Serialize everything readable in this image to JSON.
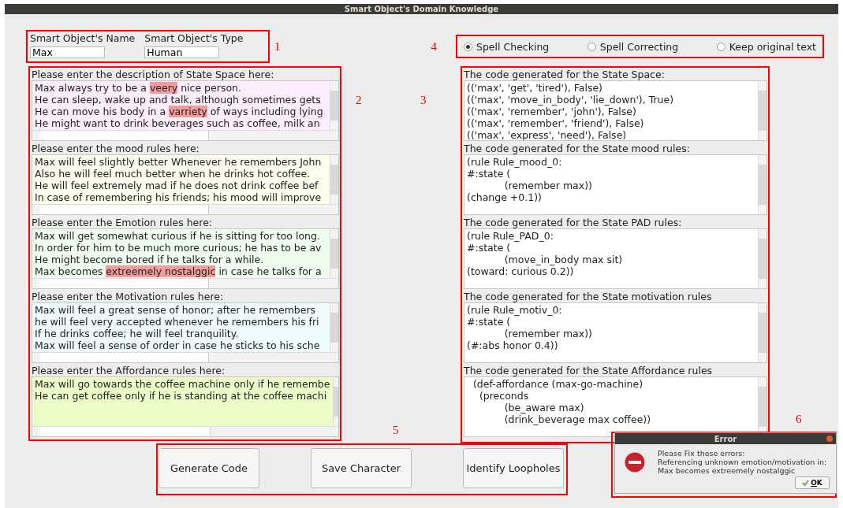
{
  "window": {
    "title": "Smart Object's Domain Knowledge"
  },
  "identity": {
    "marker": "1",
    "fields": [
      {
        "label": "Smart Object's Name",
        "value": "Max"
      },
      {
        "label": "Smart Object's Type",
        "value": "Human"
      }
    ]
  },
  "spell_mode": {
    "marker": "4",
    "options": [
      {
        "label": "Spell Checking",
        "selected": true
      },
      {
        "label": "Spell Correcting",
        "selected": false
      },
      {
        "label": "Keep original text",
        "selected": false
      }
    ]
  },
  "input_sections": {
    "marker": "2",
    "sections": [
      {
        "label": "Please enter the description of State Space here:",
        "color": "#fdeefd",
        "lines": [
          [
            {
              "text": "Max always try to be a ",
              "misspelled": false
            },
            {
              "text": "veery",
              "misspelled": true
            },
            {
              "text": " nice person.",
              "misspelled": false
            }
          ],
          [
            {
              "text": "He can sleep, wake up and talk, although sometimes gets",
              "misspelled": false
            }
          ],
          [
            {
              "text": "He can move his body in a ",
              "misspelled": false
            },
            {
              "text": "varriety",
              "misspelled": true
            },
            {
              "text": " of ways including lying",
              "misspelled": false
            }
          ],
          [
            {
              "text": "He might want to drink beverages such as coffee, milk an",
              "misspelled": false
            }
          ]
        ]
      },
      {
        "label": "Please enter the mood rules here:",
        "color": "#fefeef",
        "lines": [
          [
            {
              "text": "Max will feel slightly better Whenever he remembers John",
              "misspelled": false
            }
          ],
          [
            {
              "text": "Also he will feel much better when he drinks hot coffee.",
              "misspelled": false
            }
          ],
          [
            {
              "text": "He will feel extremely mad if he does not drink coffee bef",
              "misspelled": false
            }
          ],
          [
            {
              "text": "In case of remembering his friends; his mood will improve",
              "misspelled": false
            }
          ]
        ]
      },
      {
        "label": "Please enter the Emotion rules here:",
        "color": "#effdef",
        "lines": [
          [
            {
              "text": "Max will get somewhat curious if he is sitting for too long.",
              "misspelled": false
            }
          ],
          [
            {
              "text": "In order for him to be much more curious; he has to be av",
              "misspelled": false
            }
          ],
          [
            {
              "text": "He might become bored if he talks for a while.",
              "misspelled": false
            }
          ],
          [
            {
              "text": "Max becomes ",
              "misspelled": false
            },
            {
              "text": "extreemely ",
              "misspelled": true
            },
            {
              "text": "nostalggic",
              "misspelled": true
            },
            {
              "text": " in case he talks for a",
              "misspelled": false
            }
          ]
        ]
      },
      {
        "label": "Please enter the Motivation rules here:",
        "color": "#effcfd",
        "lines": [
          [
            {
              "text": "Max will feel a great sense of honor; after he remembers",
              "misspelled": false
            }
          ],
          [
            {
              "text": "he will feel very accepted whenever he remembers his fri",
              "misspelled": false
            }
          ],
          [
            {
              "text": "If he drinks coffee; he will feel tranquility.",
              "misspelled": false
            }
          ],
          [
            {
              "text": "Max will feel a sense of order in case he sticks to his sche",
              "misspelled": false
            }
          ]
        ]
      },
      {
        "label": "Please enter the Affordance rules here:",
        "color": "#eefec8",
        "lines": [
          [
            {
              "text": "Max will go towards the coffee machine only if he remembe",
              "misspelled": false
            }
          ],
          [
            {
              "text": "He can get coffee only if he is standing at the coffee machi",
              "misspelled": false
            }
          ]
        ]
      }
    ]
  },
  "output_sections": {
    "marker": "3",
    "sections": [
      {
        "label": "The code generated for the State Space:",
        "lines": [
          "(('max', 'get', 'tired'), False)",
          "(('max', 'move_in_body', 'lie_down'), True)",
          "(('max', 'remember', 'john'), False)",
          "(('max', 'remember', 'friend'), False)",
          "(('max', 'express', 'need'), False)"
        ]
      },
      {
        "label": "The code generated for the State mood rules:",
        "lines": [
          "(rule Rule_mood_0:",
          "#:state (",
          "            (remember max))",
          "(change +0.1))"
        ]
      },
      {
        "label": "The code generated for the State PAD rules:",
        "lines": [
          "(rule Rule_PAD_0:",
          "#:state (",
          "            (move_in_body max sit)",
          "(toward: curious 0.2))"
        ]
      },
      {
        "label": "The code generated for the State motivation rules",
        "lines": [
          "(rule Rule_motiv_0:",
          "#:state (",
          "            (remember max))",
          "(#:abs honor 0.4))"
        ]
      },
      {
        "label": "The code generated for the State Affordance rules",
        "lines": [
          "  (def-affordance (max-go-machine)",
          "    (preconds",
          "            (be_aware max)",
          "            (drink_beverage max coffee))"
        ]
      }
    ]
  },
  "actions": {
    "marker": "5",
    "buttons": [
      "Generate Code",
      "Save Character",
      "Identify Loopholes"
    ]
  },
  "error_dialog": {
    "marker": "6",
    "title": "Error",
    "message": [
      "Please Fix these errors:",
      "Referencing unknown emotion/motivation in:",
      "Max becomes extreemely nostalggic"
    ],
    "button": "OK"
  }
}
